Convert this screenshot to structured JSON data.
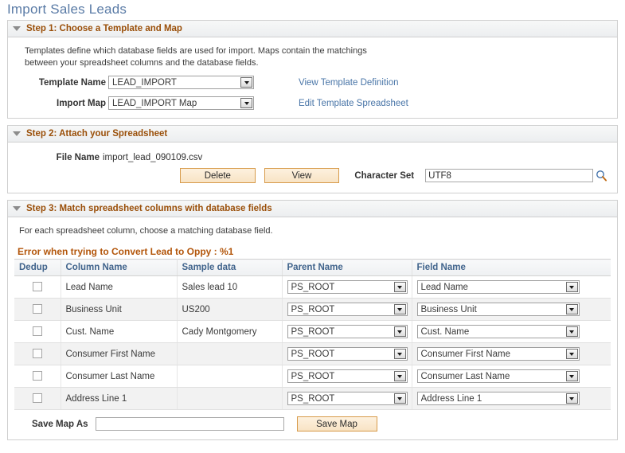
{
  "page": {
    "title": "Import Sales Leads"
  },
  "step1": {
    "header": "Step 1: Choose a Template and Map",
    "description_line1": "Templates define which database fields are used for import. Maps contain the matchings",
    "description_line2": "between your spreadsheet columns and the database fields.",
    "template_name_label": "Template Name",
    "template_name_value": "LEAD_IMPORT",
    "import_map_label": "Import Map",
    "import_map_value": "LEAD_IMPORT Map",
    "view_template_definition_link": "View Template Definition",
    "edit_template_spreadsheet_link": "Edit Template Spreadsheet"
  },
  "step2": {
    "header": "Step 2: Attach your Spreadsheet",
    "file_name_label": "File Name",
    "file_name_value": "import_lead_090109.csv",
    "delete_button": "Delete",
    "view_button": "View",
    "character_set_label": "Character Set",
    "character_set_value": "UTF8",
    "lookup_icon": "magnifier-icon"
  },
  "step3": {
    "header": "Step 3: Match spreadsheet columns with database fields",
    "instruction": "For each spreadsheet column, choose a matching database field.",
    "error_message": "Error when trying to Convert Lead to Oppy : %1",
    "columns": [
      "Dedup",
      "Column Name",
      "Sample data",
      "Parent Name",
      "Field Name"
    ],
    "rows": [
      {
        "dedup": false,
        "column_name": "Lead Name",
        "sample_data": "Sales lead 10",
        "parent_name": "PS_ROOT",
        "field_name": "Lead Name"
      },
      {
        "dedup": false,
        "column_name": "Business Unit",
        "sample_data": "US200",
        "parent_name": "PS_ROOT",
        "field_name": "Business Unit"
      },
      {
        "dedup": false,
        "column_name": "Cust. Name",
        "sample_data": "Cady Montgomery",
        "parent_name": "PS_ROOT",
        "field_name": "Cust. Name"
      },
      {
        "dedup": false,
        "column_name": "Consumer First Name",
        "sample_data": "",
        "parent_name": "PS_ROOT",
        "field_name": "Consumer First Name"
      },
      {
        "dedup": false,
        "column_name": "Consumer Last Name",
        "sample_data": "",
        "parent_name": "PS_ROOT",
        "field_name": "Consumer Last Name"
      },
      {
        "dedup": false,
        "column_name": "Address Line 1",
        "sample_data": "",
        "parent_name": "PS_ROOT",
        "field_name": "Address Line 1"
      }
    ],
    "save_map_as_label": "Save Map As",
    "save_map_as_value": "",
    "save_map_button": "Save Map"
  },
  "colors": {
    "page_title": "#5a7ba6",
    "section_header": "#9a4f09",
    "error_text": "#b3560b",
    "grid_header_text": "#41648c",
    "link": "#4a76a8",
    "button_face": "#f8e3c4",
    "button_border": "#d79b4b"
  }
}
